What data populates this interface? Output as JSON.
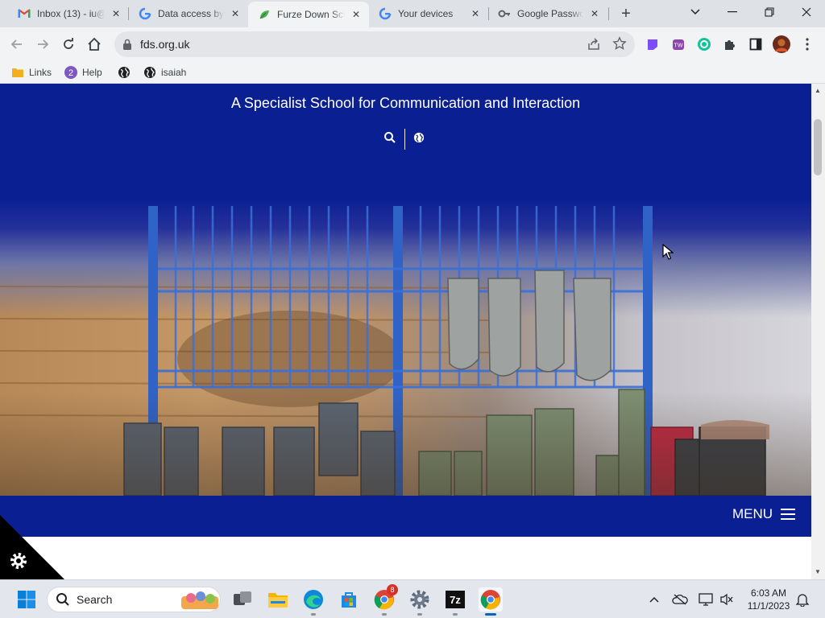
{
  "browser": {
    "tabs": [
      {
        "title": "Inbox (13) - iu@",
        "favicon": "gmail-icon",
        "active": false
      },
      {
        "title": "Data access by",
        "favicon": "google-icon",
        "active": false
      },
      {
        "title": "Furze Down Sch",
        "favicon": "leaf-icon",
        "active": true
      },
      {
        "title": "Your devices",
        "favicon": "google-icon",
        "active": false
      },
      {
        "title": "Google Passwo",
        "favicon": "key-icon",
        "active": false
      }
    ],
    "url": "fds.org.uk",
    "bookmarks": [
      {
        "label": "Links",
        "icon": "folder-icon"
      },
      {
        "label": "Help",
        "icon": "badge-2-icon"
      },
      {
        "label": "",
        "icon": "globe-icon"
      },
      {
        "label": "isaiah",
        "icon": "globe-icon"
      }
    ]
  },
  "page": {
    "tagline": "A Specialist School for Communication and Interaction",
    "menu_label": "MENU",
    "colors": {
      "header_blue": "#0a1f91"
    }
  },
  "taskbar": {
    "search_label": "Search",
    "time": "6:03 AM",
    "date": "11/1/2023",
    "chrome_badge": "8"
  }
}
